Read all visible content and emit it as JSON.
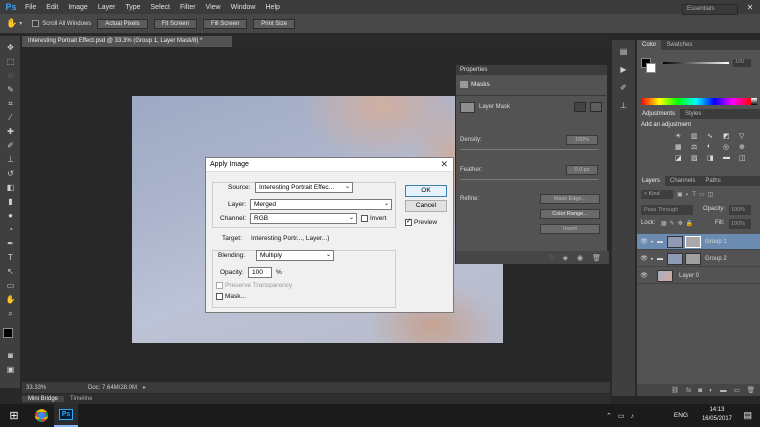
{
  "menu": {
    "logo": "Ps",
    "items": [
      "File",
      "Edit",
      "Image",
      "Layer",
      "Type",
      "Select",
      "Filter",
      "View",
      "Window",
      "Help"
    ]
  },
  "options": {
    "scroll_all": "Scroll All Windows",
    "actual_pixels": "Actual Pixels",
    "fit_screen": "Fit Screen",
    "fill_screen": "Fill Screen",
    "print_size": "Print Size",
    "workspace": "Essentials"
  },
  "document": {
    "tab_title": "Interesting Portrait Effect.psd @ 33.3% (Group 1, Layer Mask/8) *",
    "zoom": "33.33%",
    "doc_size": "Doc: 7.64M/28.0M"
  },
  "bottom_tabs": {
    "mini_bridge": "Mini Bridge",
    "timeline": "Timeline"
  },
  "properties": {
    "title": "Properties",
    "section": "Masks",
    "layer_mask": "Layer Mask",
    "density_label": "Density:",
    "density_value": "100%",
    "feather_label": "Feather:",
    "feather_value": "0.0 px",
    "refine_label": "Refine:",
    "mask_edge": "Mask Edge...",
    "color_range": "Color Range...",
    "invert": "Invert"
  },
  "color_panel": {
    "tabs": [
      "Color",
      "Swatches"
    ],
    "value": "100"
  },
  "adjustments": {
    "tabs": [
      "Adjustments",
      "Styles"
    ],
    "heading": "Add an adjustment"
  },
  "layers": {
    "tabs": [
      "Layers",
      "Channels",
      "Paths"
    ],
    "kind": "Kind",
    "blend_mode": "Pass Through",
    "opacity_label": "Opacity:",
    "opacity_value": "100%",
    "lock_label": "Lock:",
    "fill_label": "Fill:",
    "fill_value": "100%",
    "rows": [
      {
        "name": "Group 1"
      },
      {
        "name": "Group 2"
      },
      {
        "name": "Layer 0"
      }
    ]
  },
  "dialog": {
    "title": "Apply Image",
    "source_label": "Source:",
    "source_value": "Interesting Portrait Effec...",
    "layer_label": "Layer:",
    "layer_value": "Merged",
    "channel_label": "Channel:",
    "channel_value": "RGB",
    "invert_label": "Invert",
    "target_label": "Target:",
    "target_value": "Interesting Portr..., Layer...)",
    "blending_label": "Blending:",
    "blending_value": "Multiply",
    "opacity_label": "Opacity:",
    "opacity_value": "100",
    "opacity_unit": "%",
    "preserve_label": "Preserve Transparency",
    "mask_label": "Mask...",
    "ok": "OK",
    "cancel": "Cancel",
    "preview": "Preview"
  },
  "taskbar": {
    "lang": "ENG",
    "time": "14:13",
    "date": "16/05/2017",
    "ps_label": "Ps"
  }
}
